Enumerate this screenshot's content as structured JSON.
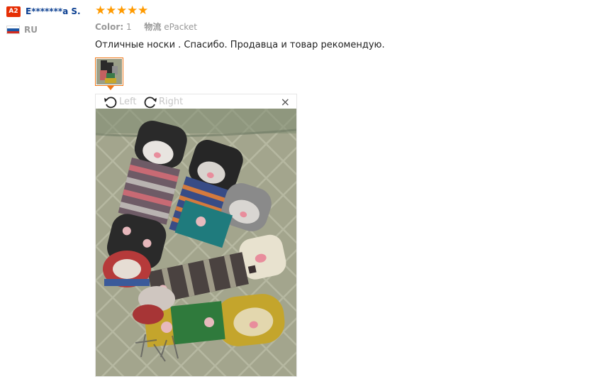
{
  "review": {
    "level_badge": "A2",
    "user_name": "E*******a S.",
    "country_code": "RU",
    "rating": 5,
    "attributes": [
      {
        "key": "Color:",
        "value": "1"
      },
      {
        "key": "物流",
        "value": "ePacket"
      }
    ],
    "text": "Отличные носки . Спасибо. Продавца и товар рекомендую."
  },
  "viewer": {
    "rotate_left_label": "Left",
    "rotate_right_label": "Right",
    "close_glyph": "×"
  },
  "colors": {
    "star": "#ff9a00",
    "username": "#0b3f91",
    "badge": "#e62e04",
    "thumb_border": "#f07818"
  },
  "icons": [
    "rotate-left-icon",
    "rotate-right-icon",
    "close-icon",
    "star-icon",
    "flag-icon"
  ]
}
